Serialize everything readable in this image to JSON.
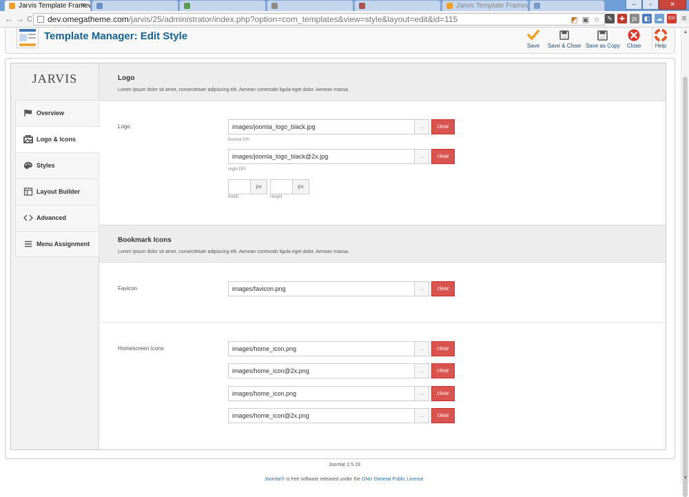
{
  "browser": {
    "tabs": [
      {
        "title": "Jarvis Template Framewor",
        "active": true
      },
      {
        "title": "",
        "active": false
      },
      {
        "title": "",
        "active": false
      },
      {
        "title": "",
        "active": false
      },
      {
        "title": "",
        "active": false
      },
      {
        "title": "Jarvis Template Framewor",
        "active": false
      },
      {
        "title": "",
        "active": false
      }
    ],
    "tab_close": "✕",
    "url_host": "dev.omegatheme.com",
    "url_path": "/jarvis/25/administrator/index.php?option=com_templates&view=style&layout=edit&id=115",
    "back": "←",
    "forward": "→",
    "reload": "C",
    "minimize": "–",
    "maximize": "▫",
    "close": "✕",
    "badge_count": "932",
    "menu_icon": "≡"
  },
  "header": {
    "title": "Template Manager: Edit Style",
    "buttons": {
      "save": "Save",
      "save_close": "Save & Close",
      "save_copy": "Save as Copy",
      "close": "Close",
      "help": "Help"
    }
  },
  "sidebar": {
    "brand": "JARVIS",
    "items": [
      {
        "label": "Overview",
        "icon": "flag-icon"
      },
      {
        "label": "Logo & Icons",
        "icon": "image-icon",
        "active": true
      },
      {
        "label": "Styles",
        "icon": "palette-icon"
      },
      {
        "label": "Layout Builder",
        "icon": "layout-icon"
      },
      {
        "label": "Advanced",
        "icon": "code-icon"
      },
      {
        "label": "Menu Assignment",
        "icon": "list-icon"
      }
    ]
  },
  "sections": {
    "logo": {
      "title": "Logo",
      "desc": "Lorem ipsum dolor sit amet, consectetuer adipiscing elit. Aenean commodo ligula eget dolor. Aenean massa.",
      "label": "Logo",
      "normal_value": "images/joomla_logo_black.jpg",
      "normal_hint": "Normal DPI",
      "high_value": "images/joomla_logo_black@2x.jpg",
      "high_hint": "Hight DPI",
      "width_unit": "px",
      "width_hint": "Width",
      "height_unit": "px",
      "height_hint": "Height"
    },
    "bookmark": {
      "title": "Bookmark Icons",
      "desc": "Lorem ipsum dolor sit amet, consectetuer adipiscing elit. Aenean commodo ligula eget dolor. Aenean massa.",
      "favicon_label": "Favicon",
      "favicon_value": "images/favicon.png",
      "homescreen_label": "Homescreen Icons",
      "homescreen_values": [
        "images/home_icon.png",
        "images/home_icon@2x.png",
        "images/home_icon.png",
        "images/home_icon@2x.png"
      ]
    }
  },
  "field": {
    "browse": "...",
    "clear": "clear"
  },
  "footer": {
    "version": "Joomla! 2.5.19",
    "line_joomla": "Joomla!®",
    "line_mid": " is free software released under the ",
    "line_license": "GNU General Public License",
    "line_end": "."
  },
  "colors": {
    "accent": "#146295",
    "clear_button": "#d9534f",
    "section_head": "#ededed"
  }
}
